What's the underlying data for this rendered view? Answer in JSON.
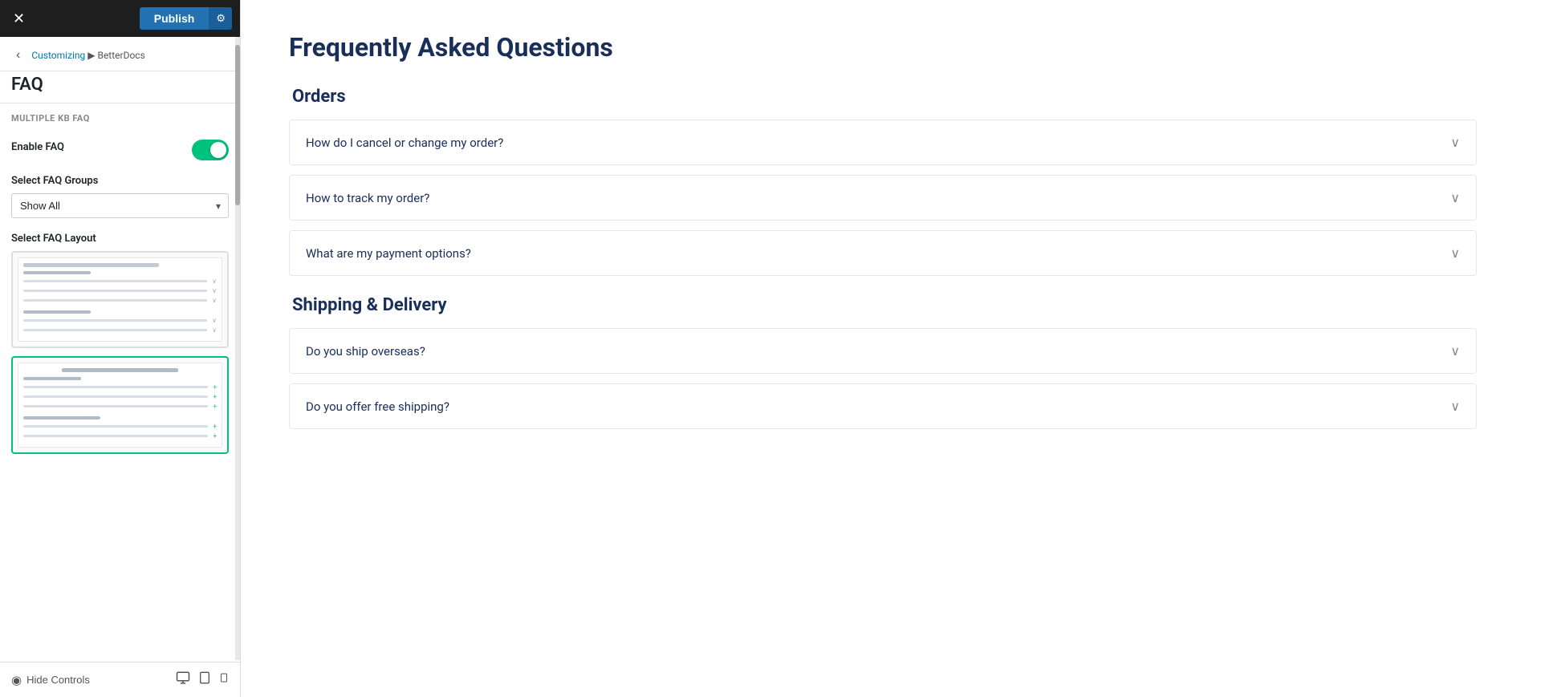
{
  "sidebar": {
    "close_label": "✕",
    "publish_label": "Publish",
    "gear_label": "⚙",
    "back_label": "‹",
    "breadcrumb": {
      "customizing": "Customizing",
      "separator": " ▶ ",
      "section": "BetterDocs"
    },
    "page_title": "FAQ",
    "section_label": "MULTIPLE KB FAQ",
    "enable_faq_label": "Enable FAQ",
    "select_groups_label": "Select FAQ Groups",
    "select_layout_label": "Select FAQ Layout",
    "faq_groups_options": [
      "Show All"
    ],
    "faq_groups_selected": "Show All",
    "layout1_selected": false,
    "layout2_selected": true
  },
  "bottom_bar": {
    "hide_controls": "Hide Controls",
    "device_desktop": "🖥",
    "device_tablet": "📱",
    "device_mobile": "📱"
  },
  "main": {
    "page_title": "Frequently Asked Questions",
    "sections": [
      {
        "title": "Orders",
        "questions": [
          "How do I cancel or change my order?",
          "How to track my order?",
          "What are my payment options?"
        ]
      },
      {
        "title": "Shipping & Delivery",
        "questions": [
          "Do you ship overseas?",
          "Do you offer free shipping?"
        ]
      }
    ]
  }
}
